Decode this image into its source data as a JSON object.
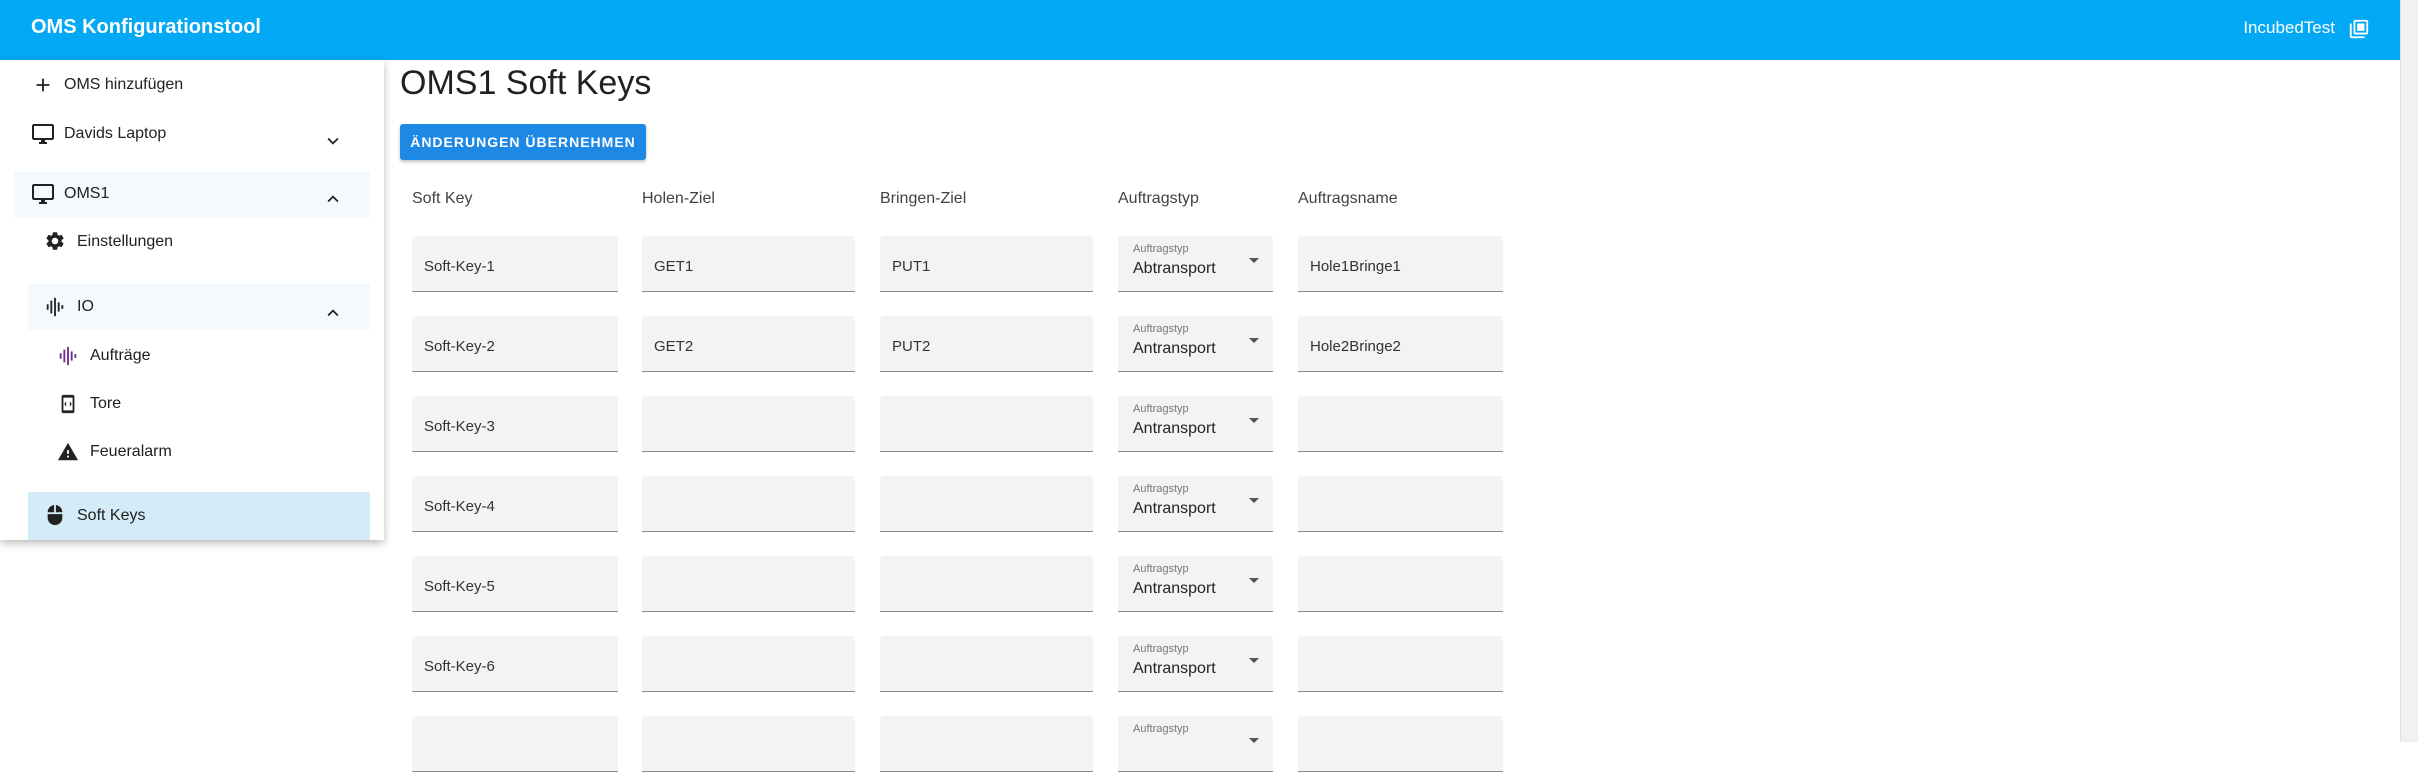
{
  "app": {
    "title": "OMS Konfigurationstool",
    "user": "IncubedTest"
  },
  "sidebar": {
    "add_oms": "OMS hinzufügen",
    "device1": "Davids Laptop",
    "device2": "OMS1",
    "settings": "Einstellungen",
    "io": "IO",
    "orders": "Aufträge",
    "gates": "Tore",
    "fire_alarm": "Feueralarm",
    "soft_keys": "Soft Keys"
  },
  "main": {
    "title": "OMS1 Soft Keys",
    "apply_button": "ÄNDERUNGEN ÜBERNEHMEN",
    "columns": [
      "Soft Key",
      "Holen-Ziel",
      "Bringen-Ziel",
      "Auftragstyp",
      "Auftragsname"
    ],
    "select_label": "Auftragstyp",
    "rows": [
      {
        "soft_key": "Soft-Key-1",
        "get": "GET1",
        "put": "PUT1",
        "type": "Abtransport",
        "name": "Hole1Bringe1"
      },
      {
        "soft_key": "Soft-Key-2",
        "get": "GET2",
        "put": "PUT2",
        "type": "Antransport",
        "name": "Hole2Bringe2"
      },
      {
        "soft_key": "Soft-Key-3",
        "get": "",
        "put": "",
        "type": "Antransport",
        "name": ""
      },
      {
        "soft_key": "Soft-Key-4",
        "get": "",
        "put": "",
        "type": "Antransport",
        "name": ""
      },
      {
        "soft_key": "Soft-Key-5",
        "get": "",
        "put": "",
        "type": "Antransport",
        "name": ""
      },
      {
        "soft_key": "Soft-Key-6",
        "get": "",
        "put": "",
        "type": "Antransport",
        "name": ""
      },
      {
        "soft_key": "",
        "get": "",
        "put": "",
        "type": "",
        "name": ""
      }
    ]
  },
  "colors": {
    "appbar": "#03a9f4",
    "button": "#1e88e5",
    "selected": "#d3ecf8",
    "io_icon": "#6a2c8a"
  }
}
